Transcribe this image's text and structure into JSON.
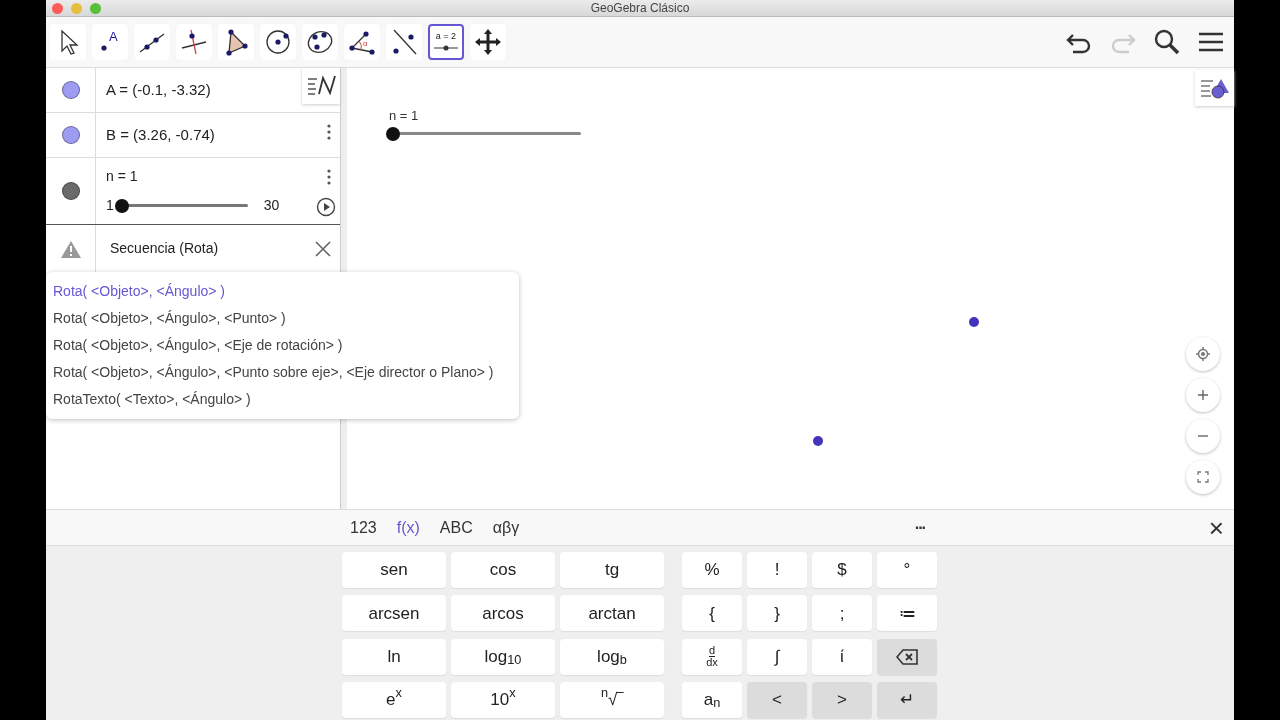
{
  "window": {
    "title": "GeoGebra Clásico"
  },
  "tools": [
    {
      "kind": "move",
      "selected": false
    },
    {
      "kind": "point",
      "label": "A",
      "selected": false
    },
    {
      "kind": "line",
      "selected": false
    },
    {
      "kind": "perpendicular",
      "selected": false
    },
    {
      "kind": "polygon",
      "selected": false
    },
    {
      "kind": "circle",
      "selected": false
    },
    {
      "kind": "conic",
      "selected": false
    },
    {
      "kind": "angle",
      "label": "α",
      "selected": false
    },
    {
      "kind": "reflect",
      "selected": false
    },
    {
      "kind": "slider",
      "label": "a = 2",
      "selected": true
    },
    {
      "kind": "pan",
      "selected": false
    }
  ],
  "actions": [
    {
      "kind": "undo",
      "disabled": false
    },
    {
      "kind": "redo",
      "disabled": true
    },
    {
      "kind": "search"
    },
    {
      "kind": "menu"
    }
  ],
  "algebra": {
    "items": [
      {
        "kind": "point",
        "text": "A = (-0.1, -3.32)",
        "color": "#9d9cf2"
      },
      {
        "kind": "point",
        "text": "B = (3.26, -0.74)",
        "color": "#9d9cf2"
      },
      {
        "kind": "slider",
        "text": "n = 1",
        "color": "#6a6a6a",
        "min": "1",
        "max": "30",
        "level": 0
      }
    ],
    "input": {
      "value": "Secuencia (Rota)"
    },
    "suggestions": [
      {
        "text": "Rota( <Objeto>, <Ángulo> )",
        "selected": true
      },
      {
        "text": "Rota( <Objeto>, <Ángulo>, <Punto> )",
        "selected": false
      },
      {
        "text": "Rota( <Objeto>, <Ángulo>, <Eje de rotación> )",
        "selected": false
      },
      {
        "text": "Rota( <Objeto>, <Ángulo>, <Punto sobre eje>, <Eje director o Plano> )",
        "selected": false
      },
      {
        "text": "RotaTexto( <Texto>, <Ángulo> )",
        "selected": false
      }
    ]
  },
  "graphics": {
    "slider": {
      "label": "n = 1",
      "level": 0
    },
    "zoom_buttons": [
      {
        "kind": "center"
      },
      {
        "kind": "plus"
      },
      {
        "kind": "minus"
      },
      {
        "kind": "fullscreen"
      }
    ]
  },
  "keyboard": {
    "tabs": [
      {
        "label": "123",
        "selected": false
      },
      {
        "label": "f(x)",
        "selected": true
      },
      {
        "label": "ABC",
        "selected": false
      },
      {
        "label": "αβγ",
        "selected": false
      }
    ],
    "more": "···",
    "close": "×",
    "left_keys": [
      {
        "label": "sen"
      },
      {
        "label": "cos"
      },
      {
        "label": "tg"
      },
      {
        "label": "arcsen"
      },
      {
        "label": "arcos"
      },
      {
        "label": "arctan"
      },
      {
        "label": "ln"
      },
      {
        "label": "log$_{10}$"
      },
      {
        "label": "log$_{b}$"
      },
      {
        "label": "e$^{x}$"
      },
      {
        "label": "10$^{x}$"
      },
      {
        "label": "$^{n}$√‾"
      }
    ],
    "right_keys": [
      {
        "kind": "text",
        "label": "%"
      },
      {
        "kind": "text",
        "label": "!"
      },
      {
        "kind": "text",
        "label": "$"
      },
      {
        "kind": "text",
        "label": "°"
      },
      {
        "kind": "text",
        "label": "{"
      },
      {
        "kind": "text",
        "label": "}"
      },
      {
        "kind": "text",
        "label": ";"
      },
      {
        "kind": "text",
        "label": "≔"
      },
      {
        "kind": "fraction",
        "num": "d",
        "den": "dx"
      },
      {
        "kind": "text",
        "label": "∫"
      },
      {
        "kind": "text",
        "label": "ί"
      },
      {
        "kind": "backspace"
      },
      {
        "kind": "text",
        "label": "a$_{n}$"
      },
      {
        "kind": "nav",
        "label": "<"
      },
      {
        "kind": "nav",
        "label": ">"
      },
      {
        "kind": "nav",
        "label": "↵"
      }
    ]
  }
}
